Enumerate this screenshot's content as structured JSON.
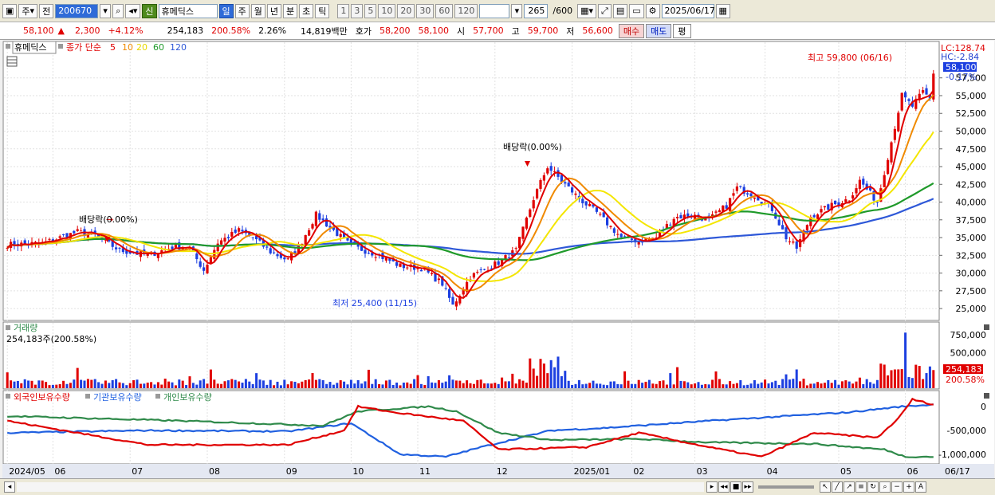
{
  "toolbar": {
    "period_selector": "주",
    "prev_label": "전",
    "stock_code": "200670",
    "new_badge": "신",
    "stock_name": "휴메딕스",
    "timeframes": [
      "일",
      "주",
      "월",
      "년",
      "분",
      "초",
      "틱"
    ],
    "active_timeframe": "일",
    "intervals": [
      "1",
      "3",
      "5",
      "10",
      "20",
      "30",
      "60",
      "120"
    ],
    "bar_count": "265",
    "bar_total": "/600",
    "date": "2025/06/17"
  },
  "quote": {
    "price": "58,100",
    "change": "2,300",
    "change_pct": "+4.12%",
    "volume": "254,183",
    "volume_ratio": "200.58%",
    "turnover": "2.26%",
    "trade_value": "14,819백만",
    "ask_label": "호가",
    "ask": "58,200",
    "bid": "58,100",
    "open_label": "시",
    "open": "57,700",
    "high_label": "고",
    "high": "59,700",
    "low_label": "저",
    "low": "56,600",
    "buy_label": "매수",
    "sell_label": "매도",
    "avg_label": "평"
  },
  "price_panel": {
    "stock_tag": "휴메딕스",
    "ma_label": "종가 단순",
    "ma_periods": [
      "5",
      "10",
      "20",
      "60",
      "120"
    ],
    "lc_label": "LC:128.74",
    "hc_label": "HC:-2.84",
    "current_price": "58,100",
    "current_pct": "-0.17%",
    "high_note": "최고 59,800 (06/16)",
    "low_note": "최저 25,400 (11/15)",
    "dividend_note": "배당락(0.00%)"
  },
  "volume_panel": {
    "title": "거래량",
    "summary": "254,183주(200.58%)",
    "current": "254,183",
    "current_pct": "200.58%"
  },
  "flow_panel": {
    "foreign_label": "외국인보유수량",
    "inst_label": "기관보유수량",
    "retail_label": "개인보유수량"
  },
  "colors": {
    "up": "#e00000",
    "down": "#1c3fe0",
    "ma5": "#e00000",
    "ma10": "#f08a00",
    "ma20": "#f4e600",
    "ma60": "#1f9a2a",
    "ma120": "#2e58d8",
    "foreign": "#e00000",
    "inst": "#2060e0",
    "retail": "#2f8a4a"
  },
  "chart_data": {
    "type": "candlestick",
    "price_axis_ticks": [
      "57,500",
      "55,000",
      "52,500",
      "50,000",
      "47,500",
      "45,000",
      "42,500",
      "40,000",
      "37,500",
      "35,000",
      "32,500",
      "30,000",
      "27,500",
      "25,000"
    ],
    "volume_axis_ticks": [
      "750,000",
      "500,000",
      "250,000"
    ],
    "flow_axis_ticks": [
      "0",
      "-500,000",
      "-1,000,000"
    ],
    "x_labels": [
      "2024/05",
      "06",
      "07",
      "08",
      "09",
      "10",
      "11",
      "12",
      "2025/01",
      "02",
      "03",
      "04",
      "05",
      "06",
      "06/17"
    ],
    "price_anchors": [
      {
        "i": 0,
        "p": 34000
      },
      {
        "i": 10,
        "p": 34200
      },
      {
        "i": 20,
        "p": 35800
      },
      {
        "i": 25,
        "p": 35300
      },
      {
        "i": 32,
        "p": 33200
      },
      {
        "i": 40,
        "p": 32500
      },
      {
        "i": 48,
        "p": 33800
      },
      {
        "i": 52,
        "p": 33500
      },
      {
        "i": 56,
        "p": 30400
      },
      {
        "i": 60,
        "p": 34300
      },
      {
        "i": 66,
        "p": 36000
      },
      {
        "i": 70,
        "p": 35000
      },
      {
        "i": 75,
        "p": 33000
      },
      {
        "i": 80,
        "p": 31800
      },
      {
        "i": 84,
        "p": 34500
      },
      {
        "i": 88,
        "p": 38200
      },
      {
        "i": 93,
        "p": 36000
      },
      {
        "i": 98,
        "p": 33800
      },
      {
        "i": 105,
        "p": 32700
      },
      {
        "i": 112,
        "p": 31000
      },
      {
        "i": 118,
        "p": 30700
      },
      {
        "i": 124,
        "p": 28500
      },
      {
        "i": 127,
        "p": 25400
      },
      {
        "i": 132,
        "p": 29500
      },
      {
        "i": 140,
        "p": 31500
      },
      {
        "i": 145,
        "p": 33200
      },
      {
        "i": 150,
        "p": 40500
      },
      {
        "i": 154,
        "p": 45000
      },
      {
        "i": 158,
        "p": 43000
      },
      {
        "i": 163,
        "p": 40500
      },
      {
        "i": 168,
        "p": 38500
      },
      {
        "i": 175,
        "p": 35000
      },
      {
        "i": 180,
        "p": 34500
      },
      {
        "i": 185,
        "p": 35000
      },
      {
        "i": 190,
        "p": 37800
      },
      {
        "i": 195,
        "p": 38200
      },
      {
        "i": 200,
        "p": 37500
      },
      {
        "i": 205,
        "p": 39500
      },
      {
        "i": 208,
        "p": 42000
      },
      {
        "i": 213,
        "p": 41000
      },
      {
        "i": 218,
        "p": 39000
      },
      {
        "i": 222,
        "p": 35000
      },
      {
        "i": 225,
        "p": 33500
      },
      {
        "i": 229,
        "p": 38000
      },
      {
        "i": 235,
        "p": 39500
      },
      {
        "i": 240,
        "p": 40500
      },
      {
        "i": 243,
        "p": 43000
      },
      {
        "i": 248,
        "p": 40000
      },
      {
        "i": 252,
        "p": 48500
      },
      {
        "i": 255,
        "p": 55000
      },
      {
        "i": 258,
        "p": 53500
      },
      {
        "i": 261,
        "p": 55500
      },
      {
        "i": 263,
        "p": 54500
      },
      {
        "i": 264,
        "p": 58100
      }
    ],
    "high_point": {
      "date": "06/16",
      "value": 59800
    },
    "low_point": {
      "date": "11/15",
      "value": 25400
    },
    "current_price": 58100
  }
}
